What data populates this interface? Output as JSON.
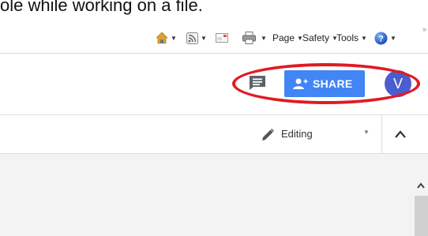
{
  "caption": {
    "text": "ole while working on a file."
  },
  "ie_toolbar": {
    "items": [
      {
        "name": "home",
        "icon": "home-icon"
      },
      {
        "name": "feeds",
        "icon": "rss-feed-icon"
      },
      {
        "name": "read-mail",
        "icon": "mail-icon"
      },
      {
        "name": "print",
        "icon": "print-icon"
      },
      {
        "name": "page",
        "label": "Page"
      },
      {
        "name": "safety",
        "label": "Safety"
      },
      {
        "name": "tools",
        "label": "Tools"
      },
      {
        "name": "help",
        "icon": "help-icon"
      }
    ],
    "overflow": "»"
  },
  "appbar": {
    "comment_icon": "comment-icon",
    "share_label": "SHARE",
    "avatar_initial": "V",
    "share_color": "#4285f4",
    "avatar_color": "#4a5ecf",
    "highlight_color": "#e01b24"
  },
  "toolbar": {
    "mode_label": "Editing",
    "mode_icon": "pencil-icon",
    "collapse_icon": "chevron-up-icon"
  },
  "document": {
    "scroll_icon": "chevron-up-icon"
  }
}
